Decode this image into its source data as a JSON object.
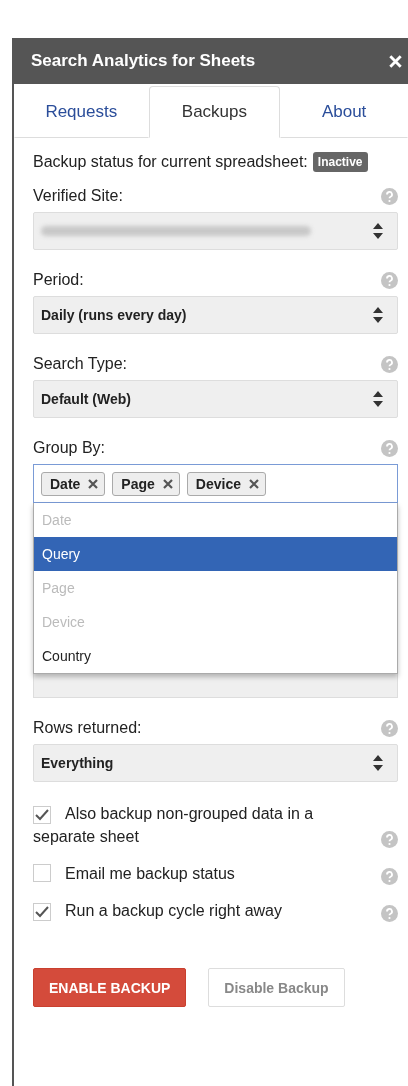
{
  "panel": {
    "title": "Search Analytics for Sheets"
  },
  "tabs": [
    {
      "label": "Requests",
      "selected": false
    },
    {
      "label": "Backups",
      "selected": true
    },
    {
      "label": "About",
      "selected": false
    }
  ],
  "status": {
    "label": "Backup status for current spreadsheet:",
    "badge": "Inactive"
  },
  "fields": [
    {
      "kind": "blurred",
      "label": "Verified Site:"
    },
    {
      "kind": "select",
      "label": "Period:",
      "value": "Daily (runs every day)"
    },
    {
      "kind": "select",
      "label": "Search Type:",
      "value": "Default (Web)"
    },
    {
      "kind": "tags",
      "label": "Group By:",
      "tags": [
        "Date",
        "Page",
        "Device"
      ],
      "options": [
        {
          "label": "Date",
          "selected": false,
          "disabled": true
        },
        {
          "label": "Query",
          "selected": true,
          "disabled": false
        },
        {
          "label": "Page",
          "selected": false,
          "disabled": true
        },
        {
          "label": "Device",
          "selected": false,
          "disabled": true
        },
        {
          "label": "Country",
          "selected": false,
          "disabled": false
        }
      ]
    },
    {
      "kind": "covered"
    },
    {
      "kind": "select",
      "label": "Rows returned:",
      "value": "Everything"
    }
  ],
  "checkboxes": [
    {
      "label": "Also backup non-grouped data in a separate sheet",
      "checked": true
    },
    {
      "label": "Email me backup status",
      "checked": false
    },
    {
      "label": "Run a backup cycle right away",
      "checked": true
    }
  ],
  "buttons": [
    {
      "label": "ENABLE BACKUP",
      "kind": "primary"
    },
    {
      "label": "Disable Backup",
      "kind": "secondary"
    }
  ]
}
